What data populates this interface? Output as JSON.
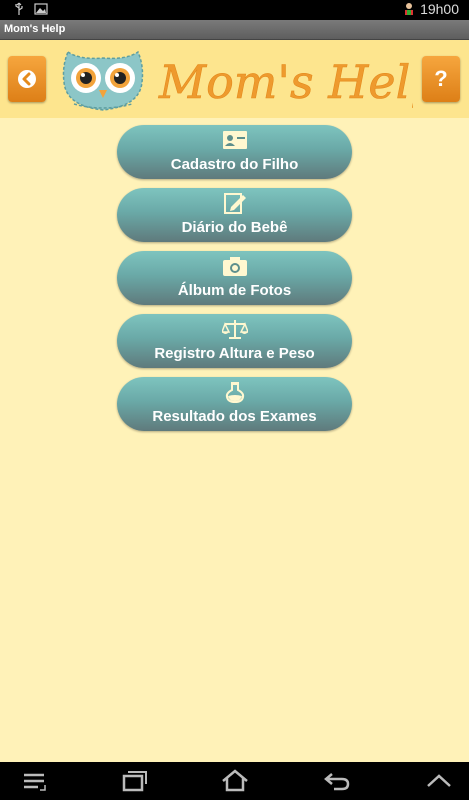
{
  "status_bar": {
    "time": "19h00",
    "left_icons": [
      "usb-icon",
      "image-icon"
    ],
    "right_icons": [
      "alert-person-icon"
    ]
  },
  "app": {
    "title": "Mom's Help"
  },
  "header": {
    "logo_text": "Mom's Help",
    "back_icon": "arrow-left-icon",
    "help_label": "?",
    "accent_color": "#f0901e",
    "logo_color": "#ee9a2e",
    "owl_color": "#8cc6c7"
  },
  "menu": {
    "items": [
      {
        "label": "Cadastro do Filho",
        "icon": "id-card-icon"
      },
      {
        "label": "Diário do Bebê",
        "icon": "edit-icon"
      },
      {
        "label": "Álbum de Fotos",
        "icon": "camera-icon"
      },
      {
        "label": "Registro Altura e Peso",
        "icon": "scale-icon"
      },
      {
        "label": "Resultado dos Exames",
        "icon": "flask-icon"
      }
    ]
  },
  "nav_bar": {
    "icons": [
      "menu-icon",
      "recent-apps-icon",
      "home-icon",
      "back-icon",
      "up-icon"
    ]
  }
}
